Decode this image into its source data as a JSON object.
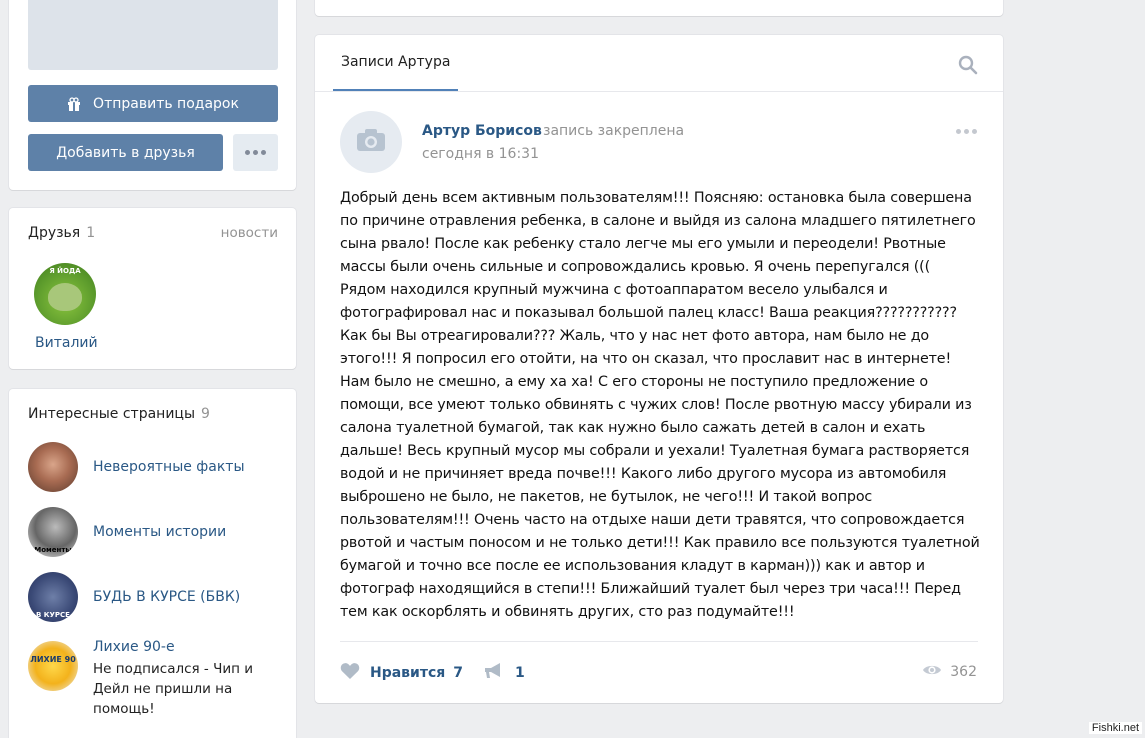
{
  "profile": {
    "gift_button": "Отправить подарок",
    "add_friend_button": "Добавить в друзья"
  },
  "friends": {
    "title": "Друзья",
    "count": "1",
    "news_link": "новости",
    "items": [
      {
        "name": "Виталий",
        "avatar_caption": "Я ЙОДА"
      }
    ]
  },
  "pages": {
    "title": "Интересные страницы",
    "count": "9",
    "items": [
      {
        "name": "Невероятные факты",
        "caption": ""
      },
      {
        "name": "Моменты истории",
        "caption": "Моменты"
      },
      {
        "name": "БУДЬ В КУРСЕ (БВК)",
        "caption": "В КУРСЕ"
      },
      {
        "name": "Лихие 90-е",
        "caption": "ЛИХИЕ 90",
        "subtitle": "Не подписался - Чип и Дейл не пришли на помощь!"
      }
    ]
  },
  "wall": {
    "tab": "Записи Артура",
    "post": {
      "author": "Артур Борисов",
      "pinned": "запись закреплена",
      "time": "сегодня в 16:31",
      "text": "Добрый день всем активным пользователям!!! Поясняю: остановка была совершена по причине отравления ребенка, в салоне и выйдя из салона младшего пятилетнего сына рвало! После как ребенку стало легче мы его умыли и переодели! Рвотные массы были очень сильные и сопровождались кровью. Я очень перепугался ((( Рядом находился крупный мужчина с фотоаппаратом весело улыбался и фотографировал нас и показывал большой палец класс! Ваша реакция??????????? Как бы Вы отреагировали??? Жаль, что у нас нет фото автора, нам было не до этого!!! Я попросил его отойти, на что он сказал, что прославит нас в интернете! Нам было не смешно, а ему ха ха! С его стороны не поступило предложение о помощи, все умеют только обвинять с чужих слов! После рвотную массу убирали из салона туалетной бумагой, так как нужно было сажать детей в салон и ехать дальше! Весь крупный мусор мы собрали и уехали! Туалетная бумага растворяется водой и не причиняет вреда почве!!! Какого либо другого мусора из автомобиля выброшено не было, не пакетов, не бутылок, не чего!!! И такой вопрос пользователям!!! Очень часто на отдыхе наши дети травятся, что сопровождается рвотой и частым поносом и не только дети!!! Как правило все пользуются туалетной бумагой и точно все после ее использования кладут в карман))) как и автор и фотограф находящийся в степи!!! Ближайший туалет был через три часа!!! Перед тем как оскорблять и обвинять других, сто раз подумайте!!!",
      "like_label": "Нравится",
      "like_count": "7",
      "share_count": "1",
      "views_count": "362"
    }
  },
  "watermark": "Fishki.net",
  "colors": {
    "accent": "#5e81a8",
    "link": "#2a5885",
    "muted": "#939393",
    "background": "#edeef0"
  }
}
